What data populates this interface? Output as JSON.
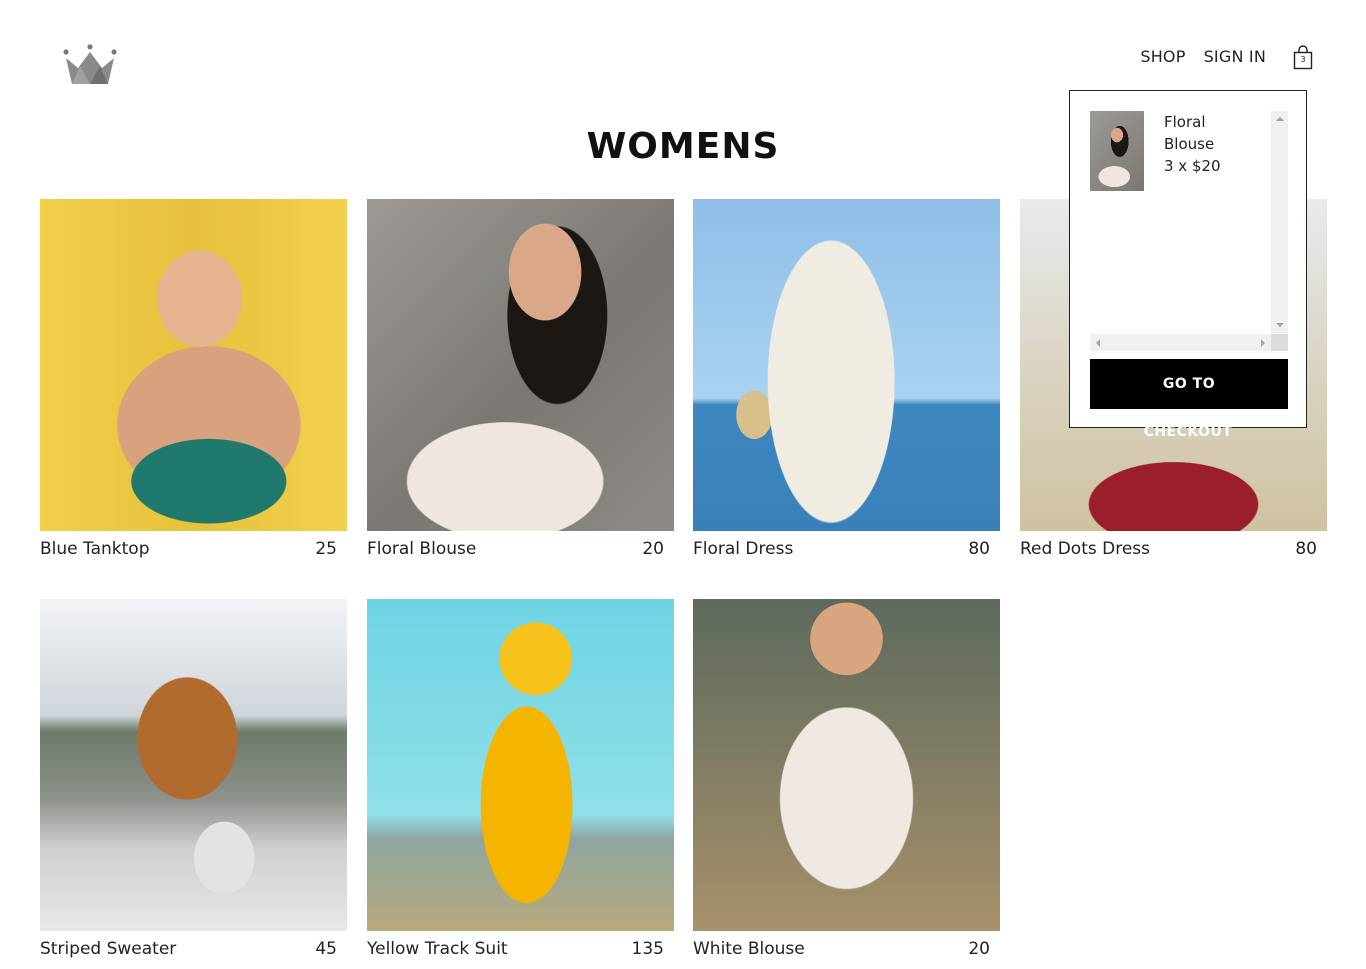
{
  "header": {
    "logo": "crown-icon",
    "nav": {
      "shop": "SHOP",
      "sign_in": "SIGN IN"
    },
    "cart": {
      "icon": "shopping-bag-icon",
      "count": "3"
    }
  },
  "page": {
    "title": "WOMENS"
  },
  "products": [
    {
      "name": "Blue Tanktop",
      "price": "25"
    },
    {
      "name": "Floral Blouse",
      "price": "20"
    },
    {
      "name": "Floral Dress",
      "price": "80"
    },
    {
      "name": "Red Dots Dress",
      "price": "80"
    },
    {
      "name": "Striped Sweater",
      "price": "45"
    },
    {
      "name": "Yellow Track Suit",
      "price": "135"
    },
    {
      "name": "White Blouse",
      "price": "20"
    }
  ],
  "cart_dropdown": {
    "items": [
      {
        "name": "Floral Blouse",
        "quantity_price": "3 x $20"
      }
    ],
    "button_line1": "GO TO",
    "button_line2": "CHECKOUT"
  },
  "colors": {
    "button_bg": "#000000",
    "text": "#222222",
    "logo": "#808080"
  }
}
